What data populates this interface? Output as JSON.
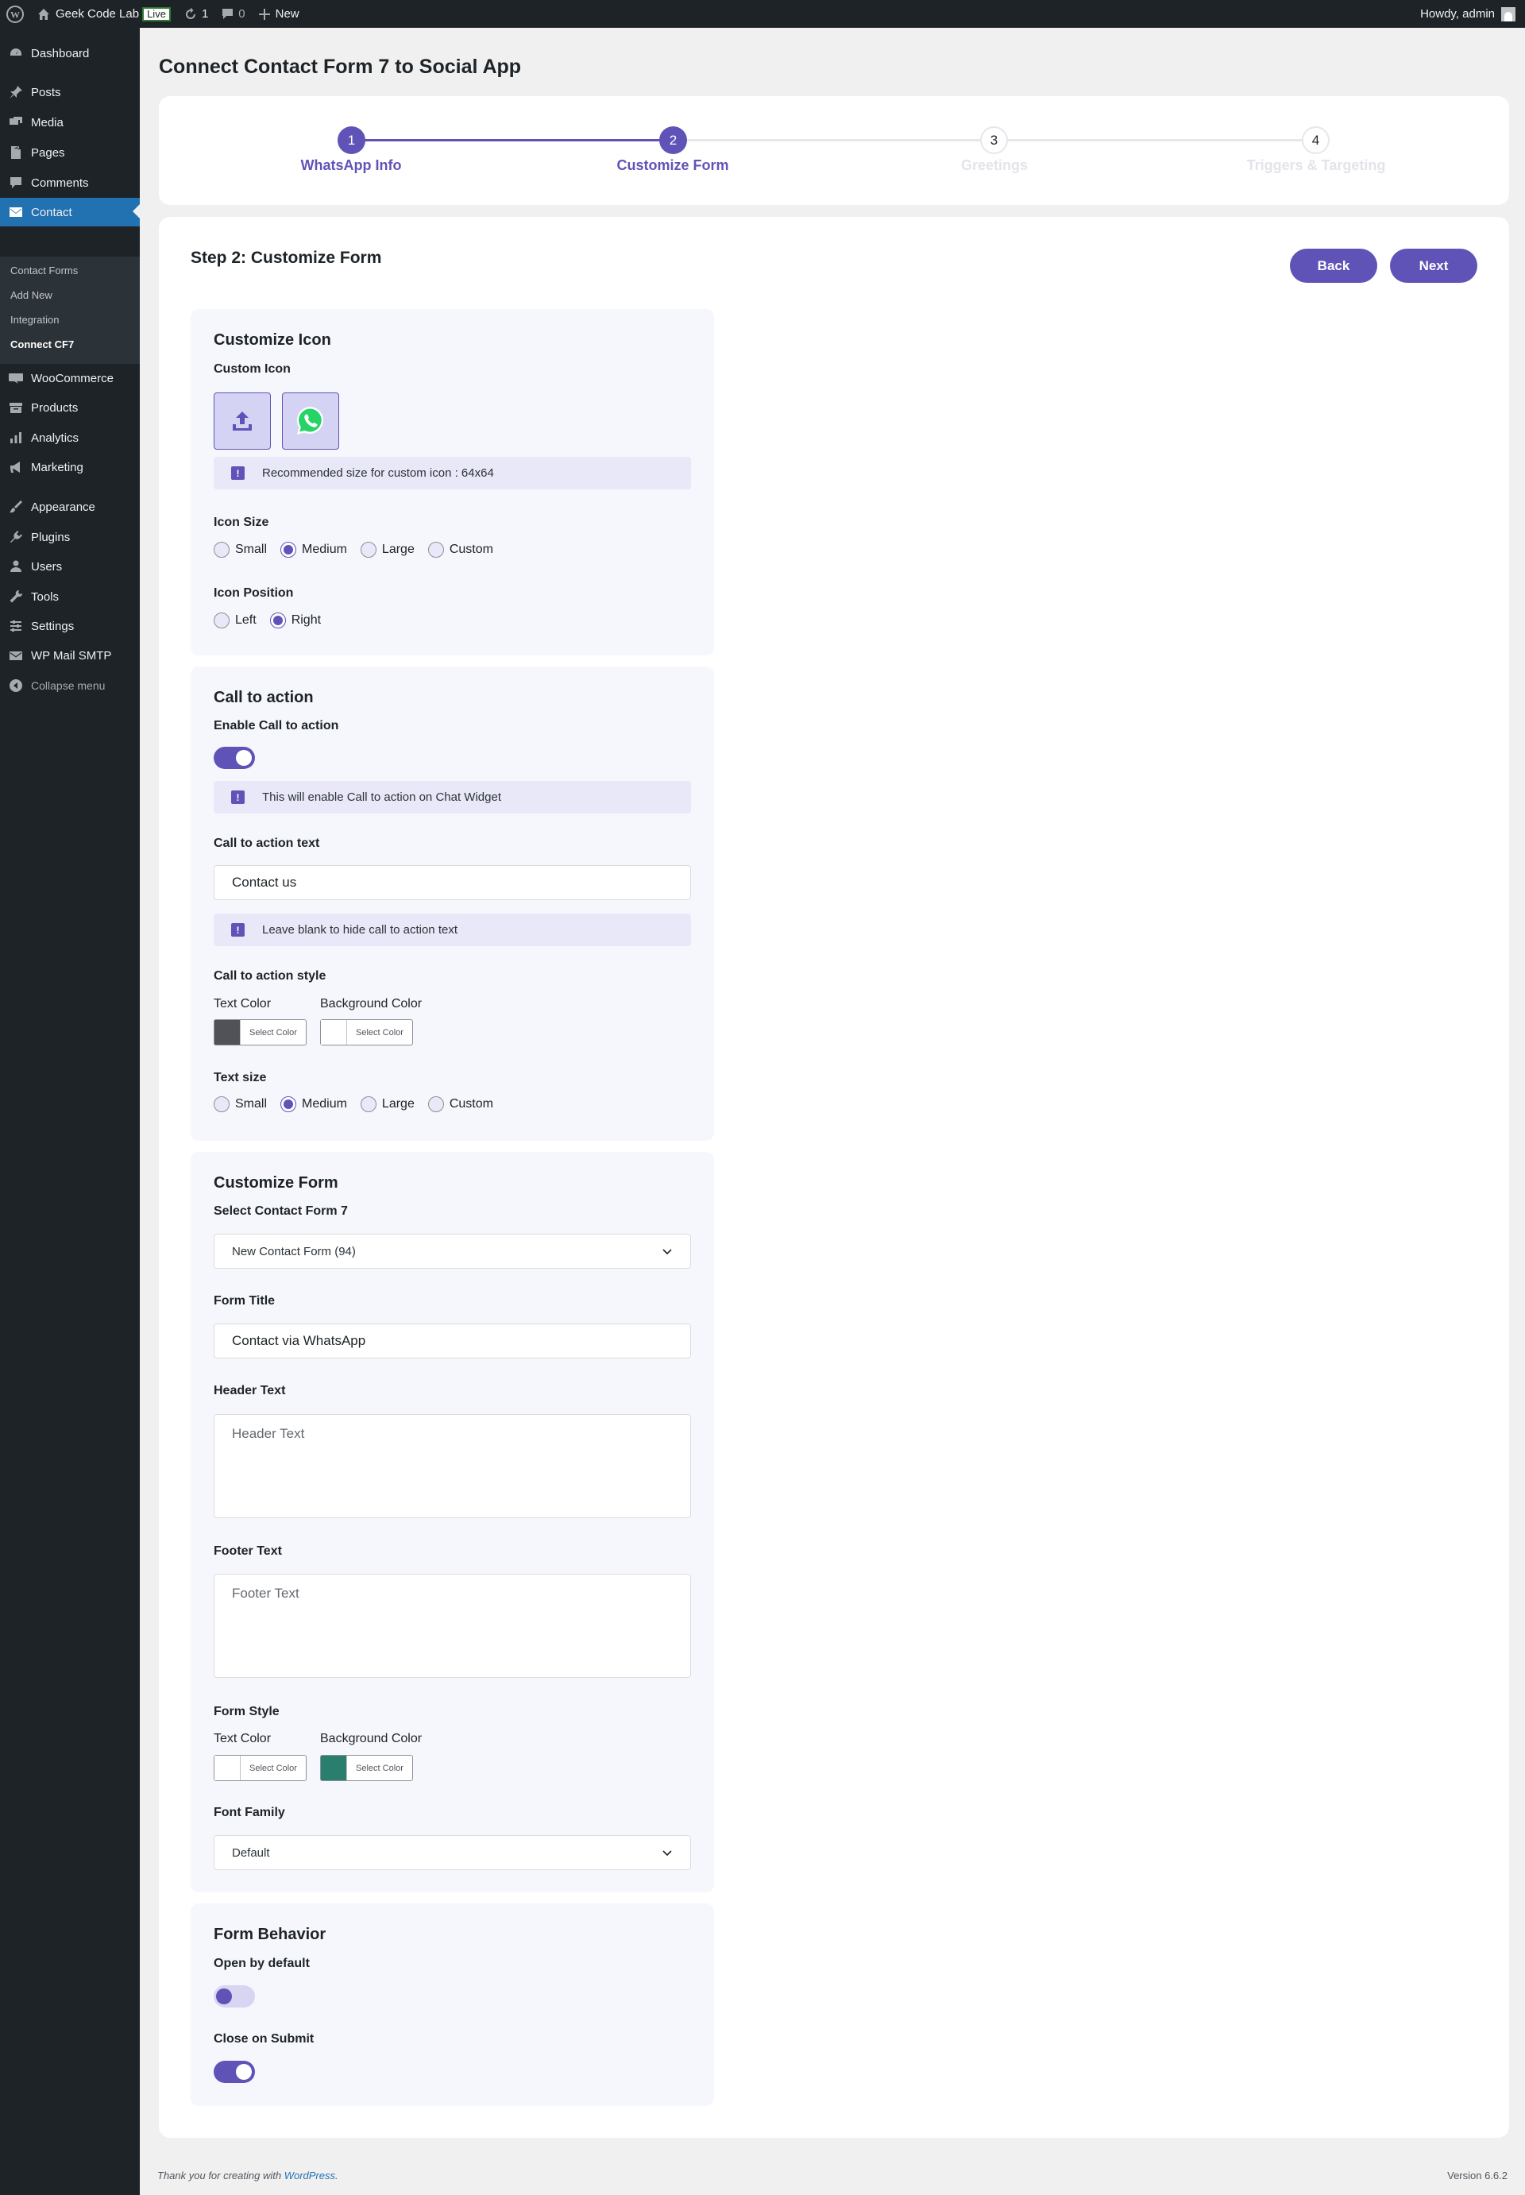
{
  "adminbar": {
    "site_name": "Geek Code Lab",
    "live_badge": "Live",
    "updates_count": "1",
    "comments_count": "0",
    "new_label": "New",
    "greeting": "Howdy, admin"
  },
  "sidebar": {
    "items": [
      {
        "label": "Dashboard",
        "icon": "dashboard-icon"
      },
      {
        "label": "Posts",
        "icon": "pin-icon"
      },
      {
        "label": "Media",
        "icon": "media-icon"
      },
      {
        "label": "Pages",
        "icon": "pages-icon"
      },
      {
        "label": "Comments",
        "icon": "comment-icon"
      },
      {
        "label": "Contact",
        "icon": "envelope-icon"
      },
      {
        "label": "WooCommerce",
        "icon": "woocommerce-icon"
      },
      {
        "label": "Products",
        "icon": "archive-icon"
      },
      {
        "label": "Analytics",
        "icon": "chart-icon"
      },
      {
        "label": "Marketing",
        "icon": "megaphone-icon"
      },
      {
        "label": "Appearance",
        "icon": "brush-icon"
      },
      {
        "label": "Plugins",
        "icon": "plug-icon"
      },
      {
        "label": "Users",
        "icon": "users-icon"
      },
      {
        "label": "Tools",
        "icon": "wrench-icon"
      },
      {
        "label": "Settings",
        "icon": "settings-icon"
      },
      {
        "label": "WP Mail SMTP",
        "icon": "wp-mail-icon"
      }
    ],
    "submenu": [
      "Contact Forms",
      "Add New",
      "Integration",
      "Connect CF7"
    ],
    "collapse_label": "Collapse menu"
  },
  "page": {
    "title": "Connect Contact Form 7 to Social App"
  },
  "steps": [
    {
      "number": "1",
      "label": "WhatsApp Info",
      "state": "done"
    },
    {
      "number": "2",
      "label": "Customize Form",
      "state": "done"
    },
    {
      "number": "3",
      "label": "Greetings",
      "state": "todo"
    },
    {
      "number": "4",
      "label": "Triggers & Targeting",
      "state": "todo"
    }
  ],
  "main": {
    "heading": "Step 2: Customize Form",
    "back_label": "Back",
    "next_label": "Next"
  },
  "customize_icon": {
    "title": "Customize Icon",
    "custom_icon_label": "Custom Icon",
    "notice": "Recommended size for custom icon : 64x64",
    "size_label": "Icon Size",
    "size_options": [
      "Small",
      "Medium",
      "Large",
      "Custom"
    ],
    "size_selected": "Medium",
    "position_label": "Icon Position",
    "position_options": [
      "Left",
      "Right"
    ],
    "position_selected": "Right"
  },
  "cta": {
    "title": "Call to action",
    "enable_label": "Enable Call to action",
    "enabled": true,
    "enable_notice": "This will enable Call to action on Chat Widget",
    "text_label": "Call to action text",
    "text_value": "Contact us",
    "text_notice": "Leave blank to hide call to action text",
    "style_label": "Call to action style",
    "text_color_label": "Text Color",
    "text_color": "#515258",
    "bg_color_label": "Background Color",
    "bg_color": "#ffffff",
    "select_color": "Select Color",
    "size_label": "Text size",
    "size_options": [
      "Small",
      "Medium",
      "Large",
      "Custom"
    ],
    "size_selected": "Medium"
  },
  "form": {
    "title": "Customize Form",
    "select_label": "Select Contact Form 7",
    "select_value": "New Contact Form (94)",
    "form_title_label": "Form Title",
    "form_title_value": "Contact via WhatsApp",
    "header_label": "Header Text",
    "header_placeholder": "Header Text",
    "footer_label": "Footer Text",
    "footer_placeholder": "Footer Text",
    "style_label": "Form Style",
    "text_color_label": "Text Color",
    "text_color": "#ffffff",
    "bg_color_label": "Background Color",
    "bg_color": "#2a7e6e",
    "select_color": "Select Color",
    "font_label": "Font Family",
    "font_value": "Default"
  },
  "behavior": {
    "title": "Form Behavior",
    "open_label": "Open by default",
    "open_enabled": false,
    "close_label": "Close on Submit",
    "close_enabled": true
  },
  "footer": {
    "thanks_prefix": "Thank you for creating with ",
    "thanks_link": "WordPress",
    "thanks_suffix": ".",
    "version": "Version 6.6.2"
  },
  "colors": {
    "accent": "#6053b7",
    "admin_blue": "#2271b1"
  }
}
